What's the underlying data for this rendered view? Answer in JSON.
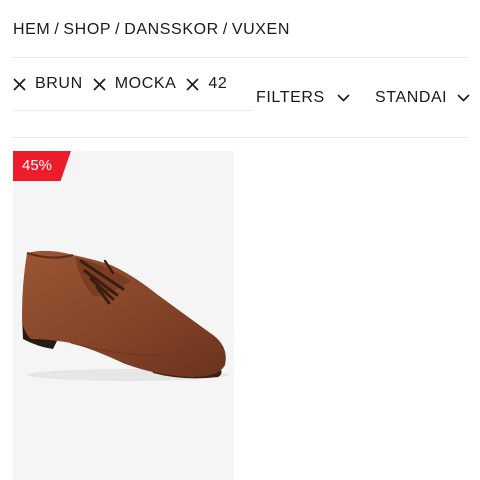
{
  "breadcrumb": {
    "items": [
      "HEM",
      "SHOP",
      "DANSSKOR",
      "VUXEN"
    ],
    "separator": "/"
  },
  "active_filters": [
    {
      "label": "BRUN",
      "icon": "close-icon"
    },
    {
      "label": "MOCKA",
      "icon": "close-icon"
    },
    {
      "label": "42",
      "icon": "close-icon"
    }
  ],
  "filters_dropdown": {
    "label": "FILTERS",
    "icon": "chevron-down-icon"
  },
  "sort_dropdown": {
    "label": "STANDARD",
    "icon": "chevron-down-icon"
  },
  "product": {
    "discount_badge": "45%",
    "image": "brown suede oxford dance shoe",
    "badge_color": "#ec1c2a",
    "suede_color": "#8a4a2b"
  }
}
